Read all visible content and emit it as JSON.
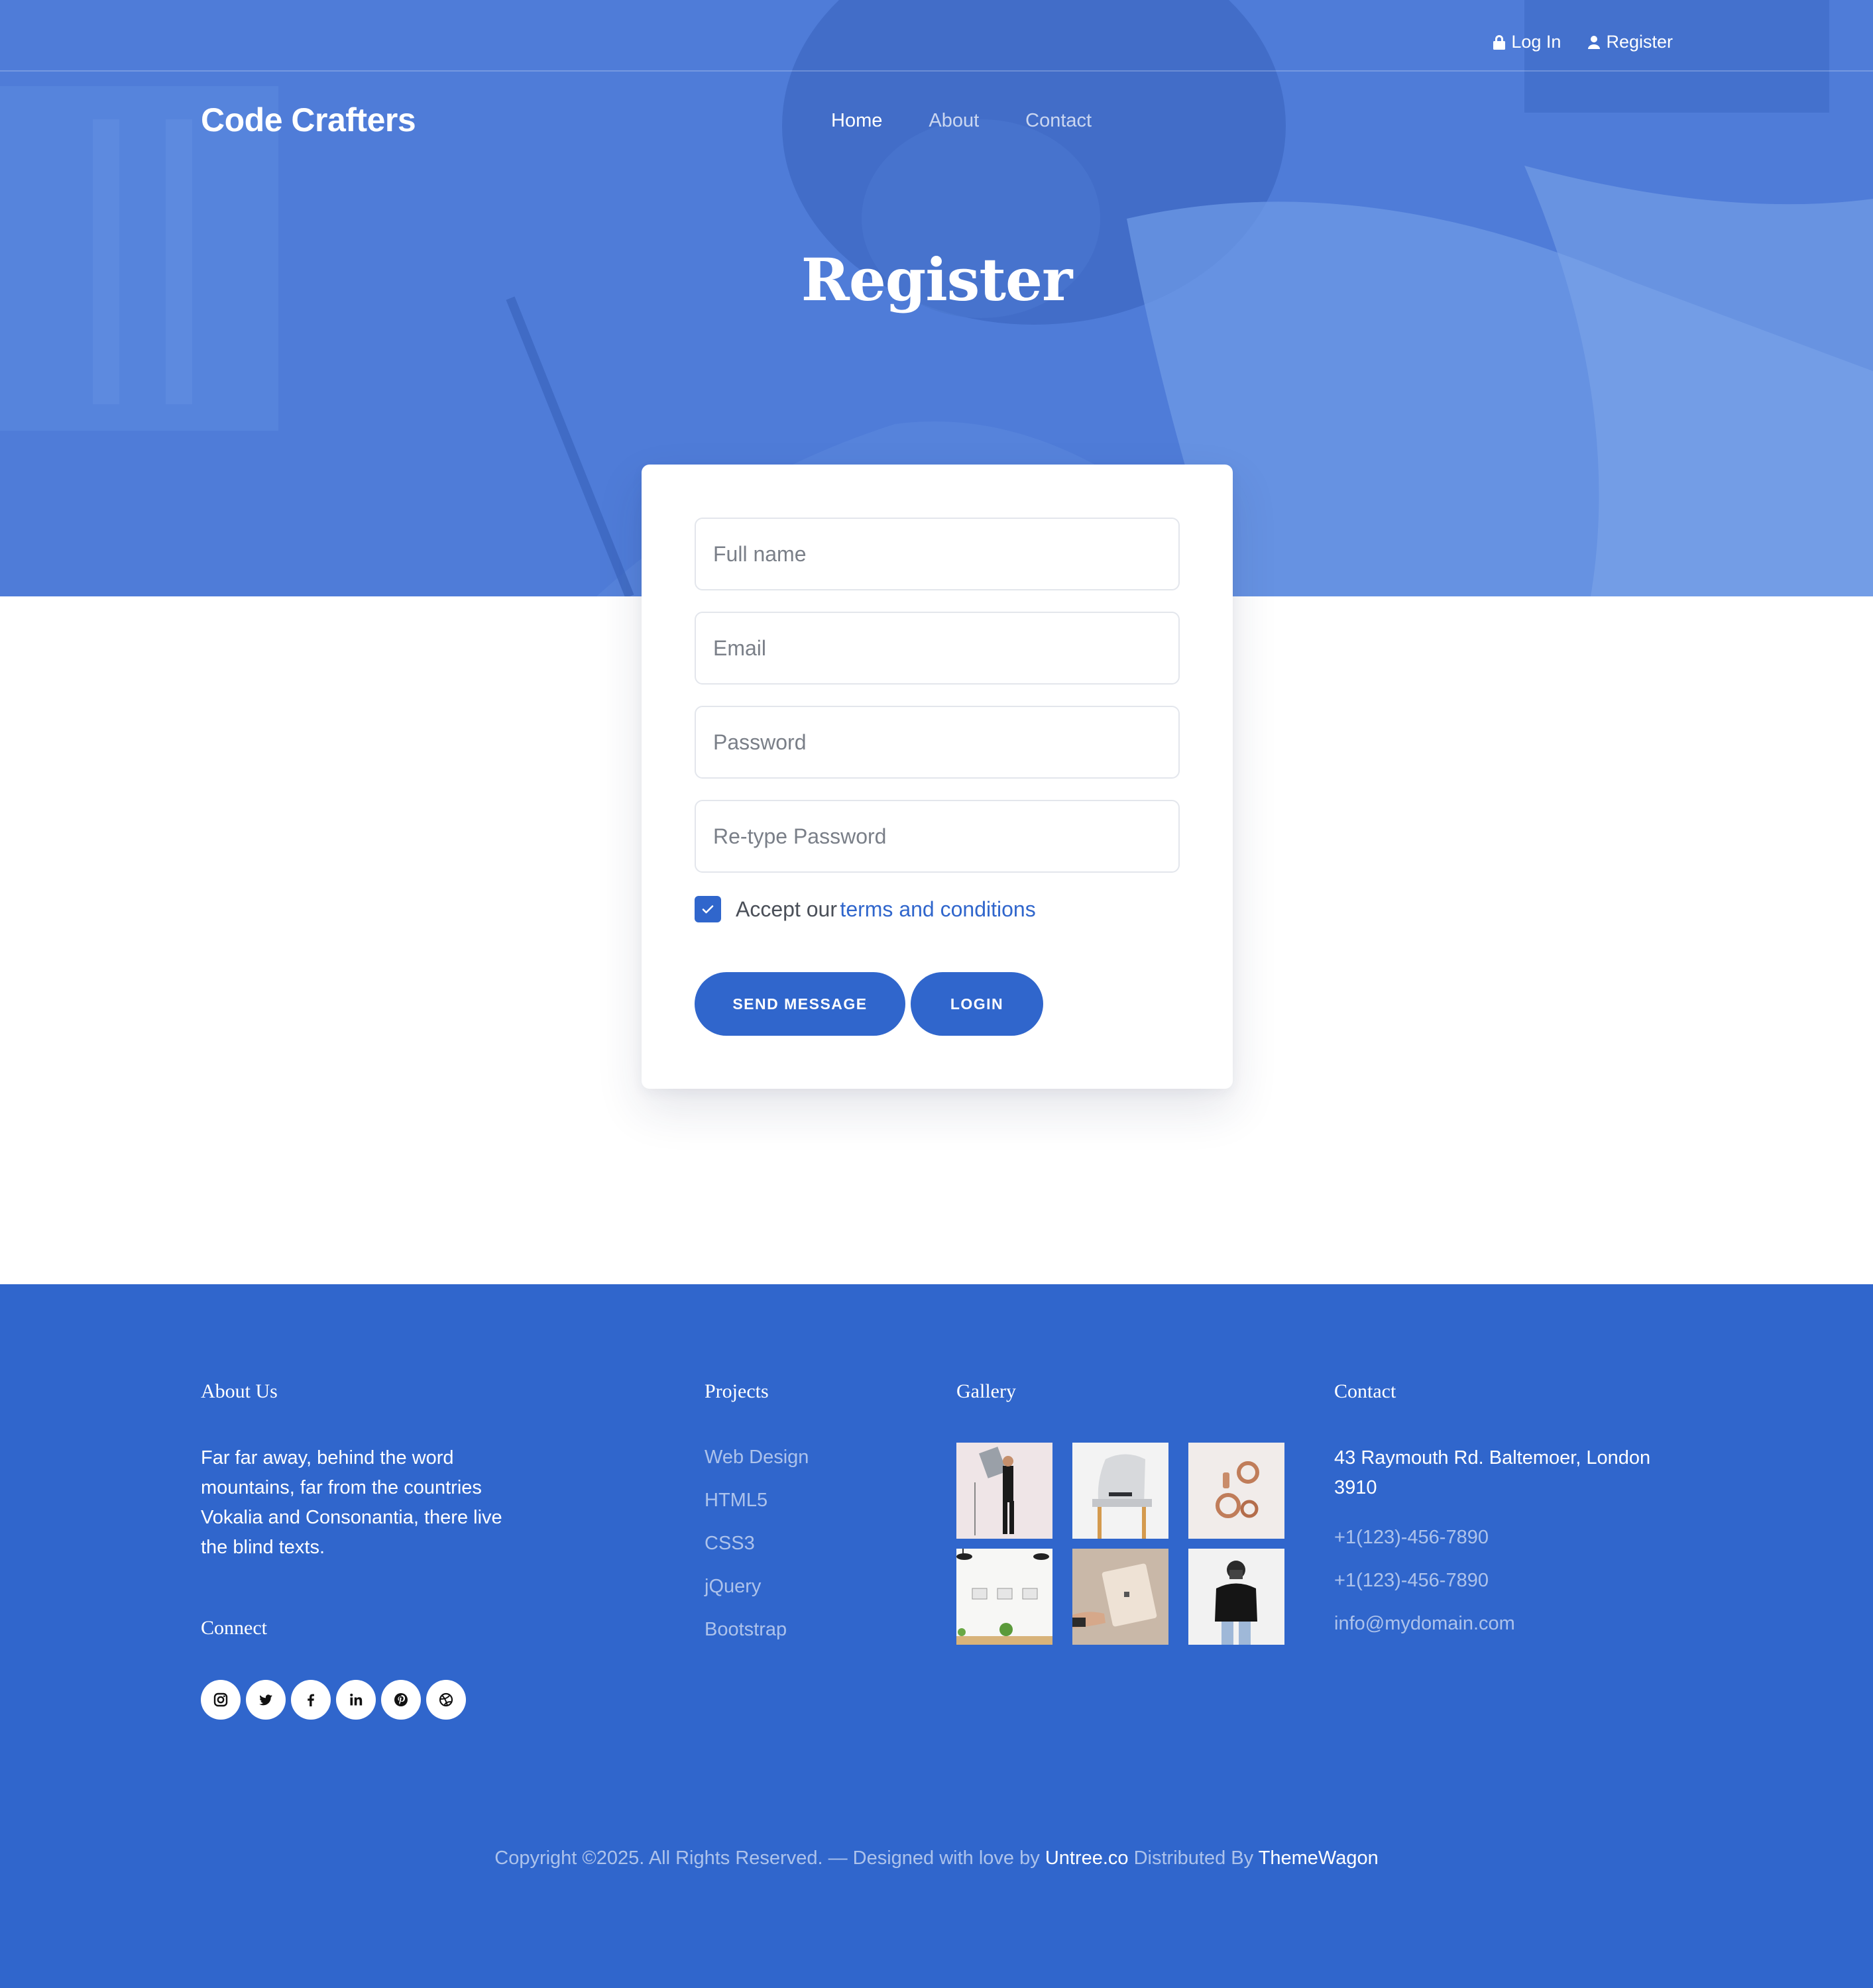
{
  "topbar": {
    "login_label": "Log In",
    "register_label": "Register"
  },
  "brand": {
    "name": "Code Crafters"
  },
  "nav": {
    "items": [
      "Home",
      "About",
      "Contact"
    ],
    "active": "Home"
  },
  "hero": {
    "title": "Register"
  },
  "form": {
    "full_name_placeholder": "Full name",
    "email_placeholder": "Email",
    "password_placeholder": "Password",
    "retype_password_placeholder": "Re-type Password",
    "accept_text": "Accept our",
    "terms_link": "terms and conditions",
    "terms_checked": true,
    "send_button": "SEND MESSAGE",
    "login_button": "LOGIN"
  },
  "footer": {
    "about": {
      "heading": "About Us",
      "text": "Far far away, behind the word mountains, far from the countries Vokalia and Consonantia, there live the blind texts."
    },
    "connect": {
      "heading": "Connect",
      "icons": [
        "instagram-icon",
        "twitter-icon",
        "facebook-icon",
        "linkedin-icon",
        "pinterest-icon",
        "dribbble-icon"
      ]
    },
    "projects": {
      "heading": "Projects",
      "items": [
        "Web Design",
        "HTML5",
        "CSS3",
        "jQuery",
        "Bootstrap"
      ]
    },
    "gallery": {
      "heading": "Gallery"
    },
    "contact": {
      "heading": "Contact",
      "address": "43 Raymouth Rd. Baltemoer, London 3910",
      "phone1": "+1(123)-456-7890",
      "phone2": "+1(123)-456-7890",
      "email": "info@mydomain.com"
    },
    "copyright": {
      "prefix": "Copyright ©2025. All Rights Reserved. — Designed with love by",
      "designer": "Untree.co",
      "distributed": "Distributed By",
      "distributor": "ThemeWagon"
    }
  },
  "colors": {
    "primary": "#3066cc",
    "hero_overlay": "#4f7cd8",
    "white": "#ffffff"
  }
}
